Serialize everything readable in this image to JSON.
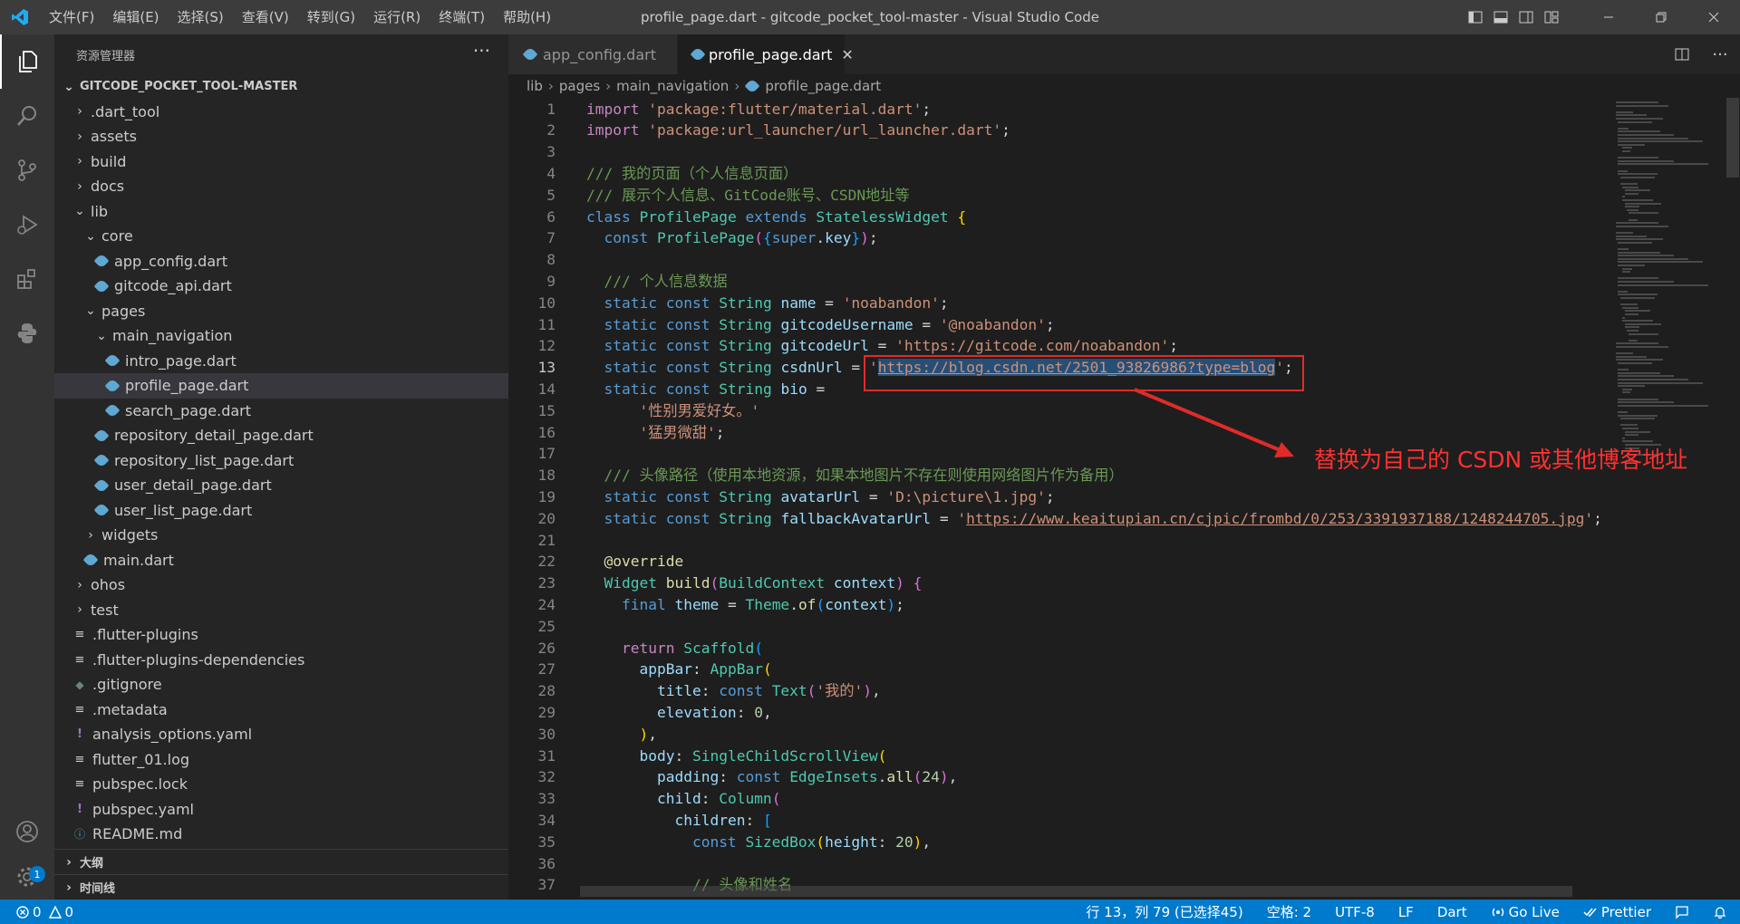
{
  "titlebar": {
    "menus": [
      "文件(F)",
      "编辑(E)",
      "选择(S)",
      "查看(V)",
      "转到(G)",
      "运行(R)",
      "终端(T)",
      "帮助(H)"
    ],
    "title": "profile_page.dart - gitcode_pocket_tool-master - Visual Studio Code"
  },
  "activity_bar": {
    "icons": [
      "explorer-icon",
      "search-icon",
      "source-control-icon",
      "run-debug-icon",
      "extensions-icon",
      "python-icon",
      "account-icon",
      "manage-gear-icon"
    ],
    "manage_badge": "1"
  },
  "sidebar": {
    "header": "资源管理器",
    "more": "···",
    "root": "GITCODE_POCKET_TOOL-MASTER",
    "items": [
      {
        "label": ".dart_tool",
        "kind": "folder",
        "open": false,
        "indent": 1
      },
      {
        "label": "assets",
        "kind": "folder",
        "open": false,
        "indent": 1
      },
      {
        "label": "build",
        "kind": "folder",
        "open": false,
        "indent": 1
      },
      {
        "label": "docs",
        "kind": "folder",
        "open": false,
        "indent": 1
      },
      {
        "label": "lib",
        "kind": "folder",
        "open": true,
        "indent": 1
      },
      {
        "label": "core",
        "kind": "folder",
        "open": true,
        "indent": 2
      },
      {
        "label": "app_config.dart",
        "kind": "dart",
        "indent": 3
      },
      {
        "label": "gitcode_api.dart",
        "kind": "dart",
        "indent": 3
      },
      {
        "label": "pages",
        "kind": "folder",
        "open": true,
        "indent": 2
      },
      {
        "label": "main_navigation",
        "kind": "folder",
        "open": true,
        "indent": 3
      },
      {
        "label": "intro_page.dart",
        "kind": "dart",
        "indent": 4
      },
      {
        "label": "profile_page.dart",
        "kind": "dart",
        "indent": 4,
        "selected": true
      },
      {
        "label": "search_page.dart",
        "kind": "dart",
        "indent": 4
      },
      {
        "label": "repository_detail_page.dart",
        "kind": "dart",
        "indent": 3
      },
      {
        "label": "repository_list_page.dart",
        "kind": "dart",
        "indent": 3
      },
      {
        "label": "user_detail_page.dart",
        "kind": "dart",
        "indent": 3
      },
      {
        "label": "user_list_page.dart",
        "kind": "dart",
        "indent": 3
      },
      {
        "label": "widgets",
        "kind": "folder",
        "open": false,
        "indent": 2
      },
      {
        "label": "main.dart",
        "kind": "dart",
        "indent": 2
      },
      {
        "label": "ohos",
        "kind": "folder",
        "open": false,
        "indent": 1
      },
      {
        "label": "test",
        "kind": "folder",
        "open": false,
        "indent": 1
      },
      {
        "label": ".flutter-plugins",
        "kind": "text",
        "indent": 1
      },
      {
        "label": ".flutter-plugins-dependencies",
        "kind": "text",
        "indent": 1
      },
      {
        "label": ".gitignore",
        "kind": "git",
        "indent": 1
      },
      {
        "label": ".metadata",
        "kind": "text",
        "indent": 1
      },
      {
        "label": "analysis_options.yaml",
        "kind": "yaml",
        "indent": 1
      },
      {
        "label": "flutter_01.log",
        "kind": "text",
        "indent": 1
      },
      {
        "label": "pubspec.lock",
        "kind": "text",
        "indent": 1
      },
      {
        "label": "pubspec.yaml",
        "kind": "yaml",
        "indent": 1
      },
      {
        "label": "README.md",
        "kind": "info",
        "indent": 1
      }
    ],
    "outline": "大纲",
    "timeline": "时间线"
  },
  "tabs": [
    {
      "label": "app_config.dart",
      "active": false
    },
    {
      "label": "profile_page.dart",
      "active": true
    }
  ],
  "breadcrumb": [
    "lib",
    "pages",
    "main_navigation",
    "profile_page.dart"
  ],
  "editor": {
    "current_line": 13,
    "lines": [
      [
        [
          "kw2",
          "import"
        ],
        [
          "pl",
          " "
        ],
        [
          "str",
          "'package:flutter/material.dart'"
        ],
        [
          "pl",
          ";"
        ]
      ],
      [
        [
          "kw2",
          "import"
        ],
        [
          "pl",
          " "
        ],
        [
          "str",
          "'package:url_launcher/url_launcher.dart'"
        ],
        [
          "pl",
          ";"
        ]
      ],
      [],
      [
        [
          "cmt",
          "/// 我的页面（个人信息页面）"
        ]
      ],
      [
        [
          "cmt",
          "/// 展示个人信息、GitCode账号、CSDN地址等"
        ]
      ],
      [
        [
          "kw",
          "class"
        ],
        [
          "pl",
          " "
        ],
        [
          "cls",
          "ProfilePage"
        ],
        [
          "pl",
          " "
        ],
        [
          "kw",
          "extends"
        ],
        [
          "pl",
          " "
        ],
        [
          "cls",
          "StatelessWidget"
        ],
        [
          "pl",
          " "
        ],
        [
          "b1",
          "{"
        ]
      ],
      [
        [
          "pl",
          "  "
        ],
        [
          "kw",
          "const"
        ],
        [
          "pl",
          " "
        ],
        [
          "cls",
          "ProfilePage"
        ],
        [
          "b2",
          "("
        ],
        [
          "b3",
          "{"
        ],
        [
          "kw",
          "super"
        ],
        [
          "pl",
          "."
        ],
        [
          "id",
          "key"
        ],
        [
          "b3",
          "}"
        ],
        [
          "b2",
          ")"
        ],
        [
          "pl",
          ";"
        ]
      ],
      [],
      [
        [
          "pl",
          "  "
        ],
        [
          "cmt",
          "/// 个人信息数据"
        ]
      ],
      [
        [
          "pl",
          "  "
        ],
        [
          "kw",
          "static"
        ],
        [
          "pl",
          " "
        ],
        [
          "kw",
          "const"
        ],
        [
          "pl",
          " "
        ],
        [
          "cls",
          "String"
        ],
        [
          "pl",
          " "
        ],
        [
          "id",
          "name"
        ],
        [
          "pl",
          " = "
        ],
        [
          "str",
          "'noabandon'"
        ],
        [
          "pl",
          ";"
        ]
      ],
      [
        [
          "pl",
          "  "
        ],
        [
          "kw",
          "static"
        ],
        [
          "pl",
          " "
        ],
        [
          "kw",
          "const"
        ],
        [
          "pl",
          " "
        ],
        [
          "cls",
          "String"
        ],
        [
          "pl",
          " "
        ],
        [
          "id",
          "gitcodeUsername"
        ],
        [
          "pl",
          " = "
        ],
        [
          "str",
          "'@noabandon'"
        ],
        [
          "pl",
          ";"
        ]
      ],
      [
        [
          "pl",
          "  "
        ],
        [
          "kw",
          "static"
        ],
        [
          "pl",
          " "
        ],
        [
          "kw",
          "const"
        ],
        [
          "pl",
          " "
        ],
        [
          "cls",
          "String"
        ],
        [
          "pl",
          " "
        ],
        [
          "id",
          "gitcodeUrl"
        ],
        [
          "pl",
          " = "
        ],
        [
          "str",
          "'https://gitcode.com/noabandon'"
        ],
        [
          "pl",
          ";"
        ]
      ],
      [
        [
          "pl",
          "  "
        ],
        [
          "kw",
          "static"
        ],
        [
          "pl",
          " "
        ],
        [
          "kw",
          "const"
        ],
        [
          "pl",
          " "
        ],
        [
          "cls",
          "String"
        ],
        [
          "pl",
          " "
        ],
        [
          "id",
          "csdnUrl"
        ],
        [
          "pl",
          " = "
        ],
        [
          "str",
          "'"
        ],
        [
          "strsel",
          "https://blog.csdn.net/2501_93826986?type=blog"
        ],
        [
          "str",
          "'"
        ],
        [
          "pl",
          ";"
        ]
      ],
      [
        [
          "pl",
          "  "
        ],
        [
          "kw",
          "static"
        ],
        [
          "pl",
          " "
        ],
        [
          "kw",
          "const"
        ],
        [
          "pl",
          " "
        ],
        [
          "cls",
          "String"
        ],
        [
          "pl",
          " "
        ],
        [
          "id",
          "bio"
        ],
        [
          "pl",
          " ="
        ]
      ],
      [
        [
          "pl",
          "      "
        ],
        [
          "str",
          "'性别男爱好女。'"
        ]
      ],
      [
        [
          "pl",
          "      "
        ],
        [
          "str",
          "'猛男微甜'"
        ],
        [
          "pl",
          ";"
        ]
      ],
      [],
      [
        [
          "pl",
          "  "
        ],
        [
          "cmt",
          "/// 头像路径（使用本地资源，如果本地图片不存在则使用网络图片作为备用）"
        ]
      ],
      [
        [
          "pl",
          "  "
        ],
        [
          "kw",
          "static"
        ],
        [
          "pl",
          " "
        ],
        [
          "kw",
          "const"
        ],
        [
          "pl",
          " "
        ],
        [
          "cls",
          "String"
        ],
        [
          "pl",
          " "
        ],
        [
          "id",
          "avatarUrl"
        ],
        [
          "pl",
          " = "
        ],
        [
          "str",
          "'D:\\picture\\1.jpg'"
        ],
        [
          "pl",
          ";"
        ]
      ],
      [
        [
          "pl",
          "  "
        ],
        [
          "kw",
          "static"
        ],
        [
          "pl",
          " "
        ],
        [
          "kw",
          "const"
        ],
        [
          "pl",
          " "
        ],
        [
          "cls",
          "String"
        ],
        [
          "pl",
          " "
        ],
        [
          "id",
          "fallbackAvatarUrl"
        ],
        [
          "pl",
          " = "
        ],
        [
          "str",
          "'"
        ],
        [
          "strurl",
          "https://www.keaitupian.cn/cjpic/frombd/0/253/3391937188/1248244705.jpg"
        ],
        [
          "str",
          "'"
        ],
        [
          "pl",
          ";"
        ]
      ],
      [],
      [
        [
          "pl",
          "  "
        ],
        [
          "fn",
          "@override"
        ]
      ],
      [
        [
          "pl",
          "  "
        ],
        [
          "cls",
          "Widget"
        ],
        [
          "pl",
          " "
        ],
        [
          "fn",
          "build"
        ],
        [
          "b2",
          "("
        ],
        [
          "cls",
          "BuildContext"
        ],
        [
          "pl",
          " "
        ],
        [
          "id",
          "context"
        ],
        [
          "b2",
          ")"
        ],
        [
          "pl",
          " "
        ],
        [
          "b2",
          "{"
        ]
      ],
      [
        [
          "pl",
          "    "
        ],
        [
          "kw",
          "final"
        ],
        [
          "pl",
          " "
        ],
        [
          "id",
          "theme"
        ],
        [
          "pl",
          " = "
        ],
        [
          "cls",
          "Theme"
        ],
        [
          "pl",
          "."
        ],
        [
          "fn",
          "of"
        ],
        [
          "b3",
          "("
        ],
        [
          "id",
          "context"
        ],
        [
          "b3",
          ")"
        ],
        [
          "pl",
          ";"
        ]
      ],
      [],
      [
        [
          "pl",
          "    "
        ],
        [
          "kw2",
          "return"
        ],
        [
          "pl",
          " "
        ],
        [
          "cls",
          "Scaffold"
        ],
        [
          "b3",
          "("
        ]
      ],
      [
        [
          "pl",
          "      "
        ],
        [
          "id",
          "appBar"
        ],
        [
          "pl",
          ": "
        ],
        [
          "cls",
          "AppBar"
        ],
        [
          "b1",
          "("
        ]
      ],
      [
        [
          "pl",
          "        "
        ],
        [
          "id",
          "title"
        ],
        [
          "pl",
          ": "
        ],
        [
          "kw",
          "const"
        ],
        [
          "pl",
          " "
        ],
        [
          "cls",
          "Text"
        ],
        [
          "b2",
          "("
        ],
        [
          "str",
          "'我的'"
        ],
        [
          "b2",
          ")"
        ],
        [
          "pl",
          ","
        ]
      ],
      [
        [
          "pl",
          "        "
        ],
        [
          "id",
          "elevation"
        ],
        [
          "pl",
          ": "
        ],
        [
          "num",
          "0"
        ],
        [
          "pl",
          ","
        ]
      ],
      [
        [
          "pl",
          "      "
        ],
        [
          "b1",
          ")"
        ],
        [
          "pl",
          ","
        ]
      ],
      [
        [
          "pl",
          "      "
        ],
        [
          "id",
          "body"
        ],
        [
          "pl",
          ": "
        ],
        [
          "cls",
          "SingleChildScrollView"
        ],
        [
          "b1",
          "("
        ]
      ],
      [
        [
          "pl",
          "        "
        ],
        [
          "id",
          "padding"
        ],
        [
          "pl",
          ": "
        ],
        [
          "kw",
          "const"
        ],
        [
          "pl",
          " "
        ],
        [
          "cls",
          "EdgeInsets"
        ],
        [
          "pl",
          "."
        ],
        [
          "fn",
          "all"
        ],
        [
          "b2",
          "("
        ],
        [
          "num",
          "24"
        ],
        [
          "b2",
          ")"
        ],
        [
          "pl",
          ","
        ]
      ],
      [
        [
          "pl",
          "        "
        ],
        [
          "id",
          "child"
        ],
        [
          "pl",
          ": "
        ],
        [
          "cls",
          "Column"
        ],
        [
          "b2",
          "("
        ]
      ],
      [
        [
          "pl",
          "          "
        ],
        [
          "id",
          "children"
        ],
        [
          "pl",
          ": "
        ],
        [
          "b3",
          "["
        ]
      ],
      [
        [
          "pl",
          "            "
        ],
        [
          "kw",
          "const"
        ],
        [
          "pl",
          " "
        ],
        [
          "cls",
          "SizedBox"
        ],
        [
          "b1",
          "("
        ],
        [
          "id",
          "height"
        ],
        [
          "pl",
          ": "
        ],
        [
          "num",
          "20"
        ],
        [
          "b1",
          ")"
        ],
        [
          "pl",
          ","
        ]
      ],
      [],
      [
        [
          "pl",
          "            "
        ],
        [
          "cmt",
          "// 头像和姓名"
        ]
      ]
    ]
  },
  "annotation": "替换为自己的 CSDN 或其他博客地址",
  "statusbar": {
    "errors": "0",
    "warnings": "0",
    "position": "行 13，列 79 (已选择45)",
    "spaces": "空格: 2",
    "encoding": "UTF-8",
    "eol": "LF",
    "language": "Dart",
    "golive": "Go Live",
    "prettier": "Prettier"
  },
  "colors": {
    "accent": "#007acc",
    "annotation": "#e02b2b"
  }
}
